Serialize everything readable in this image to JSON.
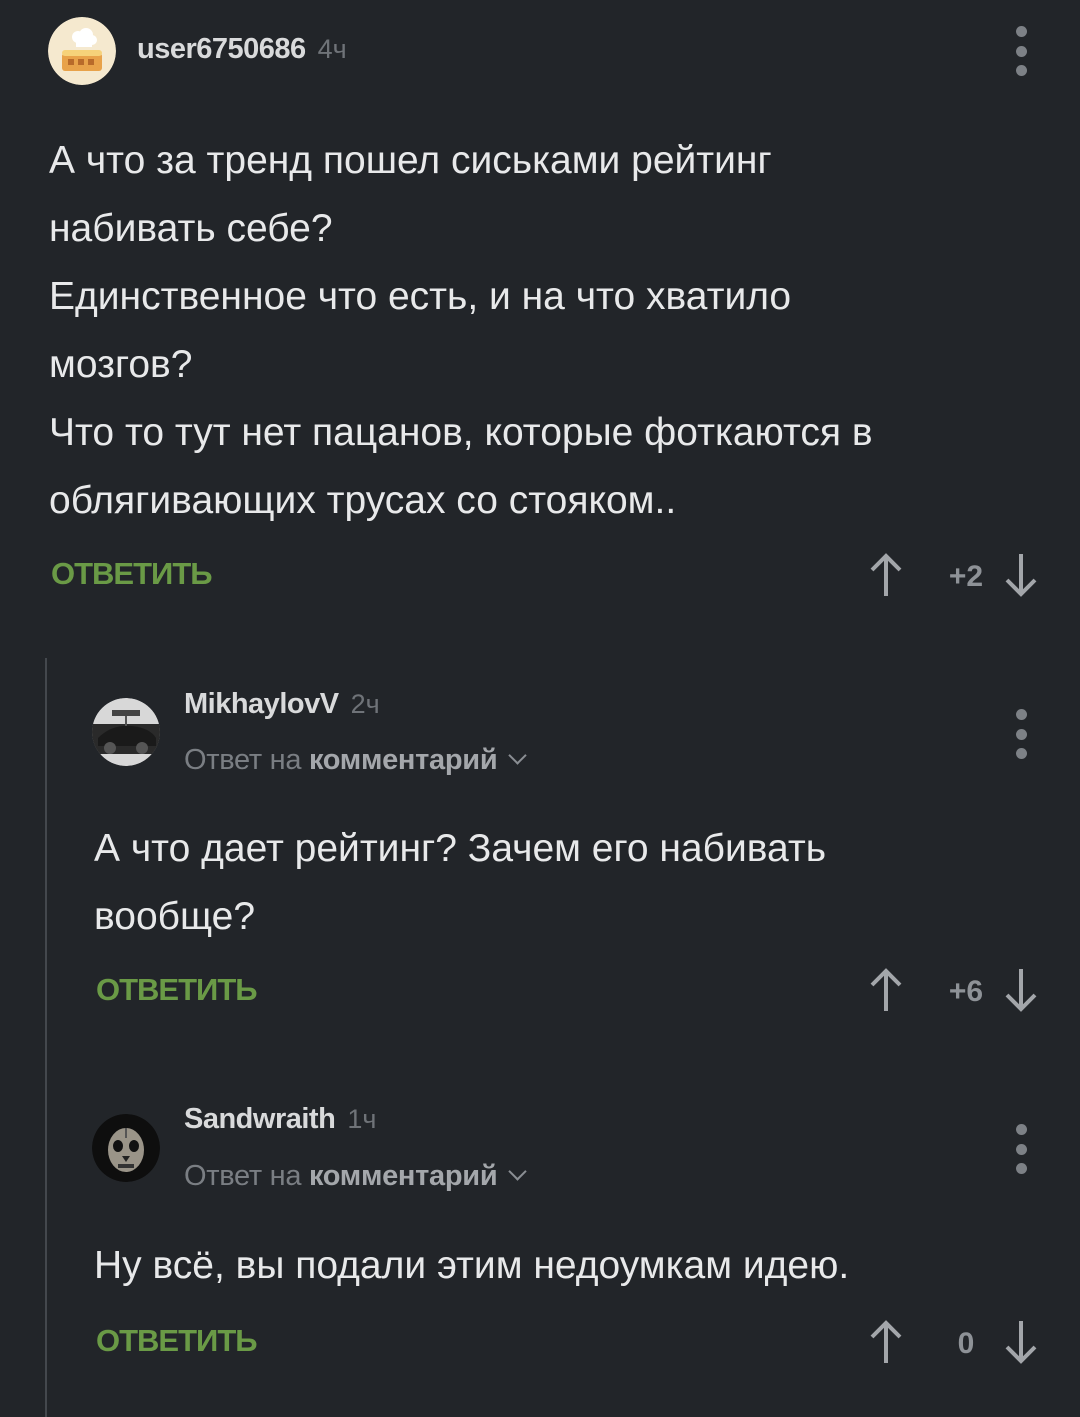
{
  "comments": [
    {
      "username": "user6750686",
      "time": "4ч",
      "body": "А что за тренд пошел сиськами рейтинг\nнабивать себе?\nЕдинственное что есть, и на что хватило\nмозгов?\nЧто то тут нет пацанов, которые фоткаются в\nоблягивающих трусах со стояком..",
      "reply_label": "ОТВЕТИТЬ",
      "score": "+2",
      "avatar_icon": "cake-avatar-icon"
    },
    {
      "username": "MikhaylovV",
      "time": "2ч",
      "reply_to_prefix": "Ответ на",
      "reply_to_link": "комментарий",
      "body": "А что дает рейтинг? Зачем его набивать\nвообще?",
      "reply_label": "ОТВЕТИТЬ",
      "score": "+6",
      "avatar_icon": "car-photo-avatar-icon"
    },
    {
      "username": "Sandwraith",
      "time": "1ч",
      "reply_to_prefix": "Ответ на",
      "reply_to_link": "комментарий",
      "body": "Ну всё, вы подали этим недоумкам идею.",
      "reply_label": "ОТВЕТИТЬ",
      "score": "0",
      "avatar_icon": "skull-mask-avatar-icon"
    }
  ],
  "colors": {
    "background": "#222529",
    "reply_green": "#6a9a46",
    "muted": "#7a7e83",
    "text": "#e8e9ea"
  }
}
